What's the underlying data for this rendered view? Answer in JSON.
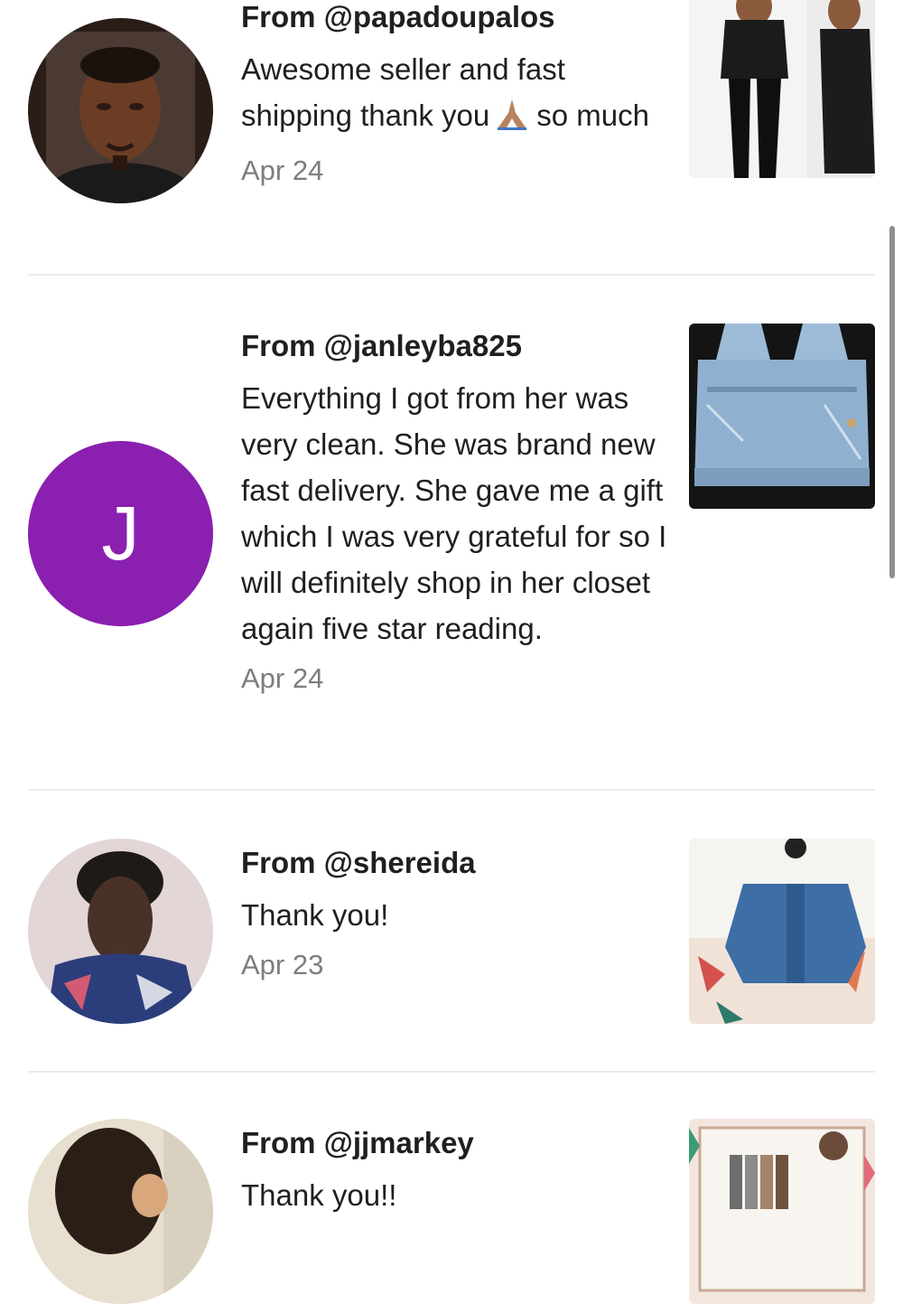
{
  "reviews": [
    {
      "from": "From @papadoupalos",
      "message_part1": "Awesome seller and fast shipping thank you",
      "emoji": "folded-hands-emoji",
      "message_part2": "so much",
      "date": "Apr 24",
      "avatar_type": "photo"
    },
    {
      "from": "From @janleyba825",
      "message": "Everything I got from her was very clean. She was brand new fast delivery. She gave me a gift which I was very grateful for so I will definitely shop in her closet again five star reading.",
      "date": "Apr 24",
      "avatar_type": "letter",
      "avatar_letter": "J",
      "avatar_color": "#8a1fb0"
    },
    {
      "from": "From @shereida",
      "message": "Thank you!",
      "date": "Apr 23",
      "avatar_type": "photo"
    },
    {
      "from": "From @jjmarkey",
      "message": "Thank you!!",
      "avatar_type": "photo"
    }
  ],
  "colors": {
    "divider": "#ececec",
    "date_text": "#7d7d7d",
    "scrollbar": "#8e8e8e"
  }
}
